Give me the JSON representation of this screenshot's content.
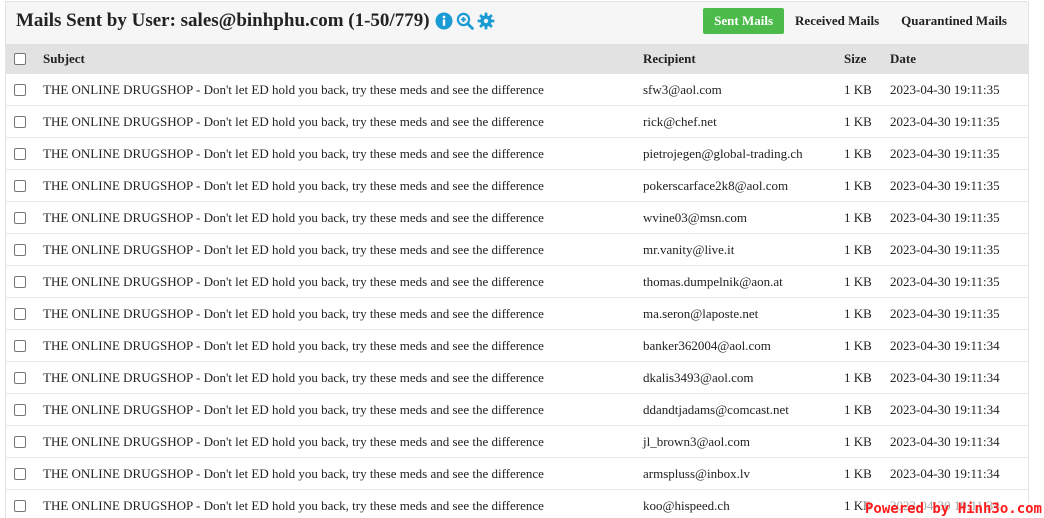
{
  "page": {
    "title": "Mails Sent by User: sales@binhphu.com (1-50/779)",
    "accent": "#4cbb4c",
    "icon_color": "#1a9bd4"
  },
  "header_icons": [
    {
      "name": "info-icon"
    },
    {
      "name": "zoom-search-icon"
    },
    {
      "name": "gear-icon"
    }
  ],
  "tabs": [
    {
      "label": "Sent Mails",
      "active": true
    },
    {
      "label": "Received Mails",
      "active": false
    },
    {
      "label": "Quarantined Mails",
      "active": false
    }
  ],
  "table": {
    "columns": {
      "subject": "Subject",
      "recipient": "Recipient",
      "size": "Size",
      "date": "Date"
    },
    "rows": [
      {
        "subject": "THE ONLINE DRUGSHOP - Don't let ED hold you back, try these meds and see the difference",
        "recipient": "sfw3@aol.com",
        "size": "1 KB",
        "date": "2023-04-30 19:11:35"
      },
      {
        "subject": "THE ONLINE DRUGSHOP - Don't let ED hold you back, try these meds and see the difference",
        "recipient": "rick@chef.net",
        "size": "1 KB",
        "date": "2023-04-30 19:11:35"
      },
      {
        "subject": "THE ONLINE DRUGSHOP - Don't let ED hold you back, try these meds and see the difference",
        "recipient": "pietrojegen@global-trading.ch",
        "size": "1 KB",
        "date": "2023-04-30 19:11:35"
      },
      {
        "subject": "THE ONLINE DRUGSHOP - Don't let ED hold you back, try these meds and see the difference",
        "recipient": "pokerscarface2k8@aol.com",
        "size": "1 KB",
        "date": "2023-04-30 19:11:35"
      },
      {
        "subject": "THE ONLINE DRUGSHOP - Don't let ED hold you back, try these meds and see the difference",
        "recipient": "wvine03@msn.com",
        "size": "1 KB",
        "date": "2023-04-30 19:11:35"
      },
      {
        "subject": "THE ONLINE DRUGSHOP - Don't let ED hold you back, try these meds and see the difference",
        "recipient": "mr.vanity@live.it",
        "size": "1 KB",
        "date": "2023-04-30 19:11:35"
      },
      {
        "subject": "THE ONLINE DRUGSHOP - Don't let ED hold you back, try these meds and see the difference",
        "recipient": "thomas.dumpelnik@aon.at",
        "size": "1 KB",
        "date": "2023-04-30 19:11:35"
      },
      {
        "subject": "THE ONLINE DRUGSHOP - Don't let ED hold you back, try these meds and see the difference",
        "recipient": "ma.seron@laposte.net",
        "size": "1 KB",
        "date": "2023-04-30 19:11:35"
      },
      {
        "subject": "THE ONLINE DRUGSHOP - Don't let ED hold you back, try these meds and see the difference",
        "recipient": "banker362004@aol.com",
        "size": "1 KB",
        "date": "2023-04-30 19:11:34"
      },
      {
        "subject": "THE ONLINE DRUGSHOP - Don't let ED hold you back, try these meds and see the difference",
        "recipient": "dkalis3493@aol.com",
        "size": "1 KB",
        "date": "2023-04-30 19:11:34"
      },
      {
        "subject": "THE ONLINE DRUGSHOP - Don't let ED hold you back, try these meds and see the difference",
        "recipient": "ddandtjadams@comcast.net",
        "size": "1 KB",
        "date": "2023-04-30 19:11:34"
      },
      {
        "subject": "THE ONLINE DRUGSHOP - Don't let ED hold you back, try these meds and see the difference",
        "recipient": "jl_brown3@aol.com",
        "size": "1 KB",
        "date": "2023-04-30 19:11:34"
      },
      {
        "subject": "THE ONLINE DRUGSHOP - Don't let ED hold you back, try these meds and see the difference",
        "recipient": "armspluss@inbox.lv",
        "size": "1 KB",
        "date": "2023-04-30 19:11:34"
      },
      {
        "subject": "THE ONLINE DRUGSHOP - Don't let ED hold you back, try these meds and see the difference",
        "recipient": "koo@hispeed.ch",
        "size": "1 KB",
        "date": "2023-04-30 19:11:34"
      }
    ]
  },
  "watermark": "Powered by Hinh3o.com"
}
